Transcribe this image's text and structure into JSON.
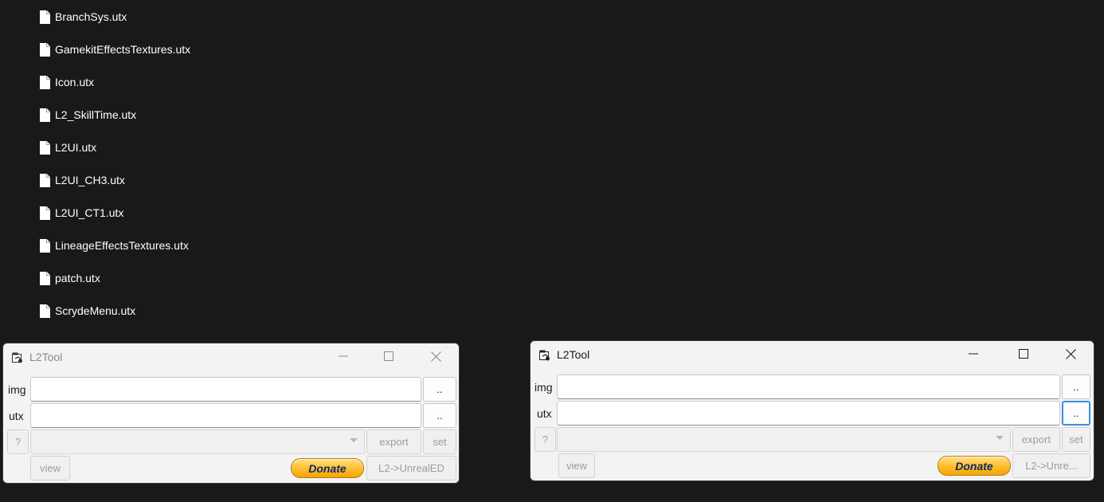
{
  "desktop_files": [
    {
      "name": "BranchSys.utx"
    },
    {
      "name": "GamekitEffectsTextures.utx"
    },
    {
      "name": "Icon.utx"
    },
    {
      "name": "L2_SkillTime.utx"
    },
    {
      "name": "L2UI.utx"
    },
    {
      "name": "L2UI_CH3.utx"
    },
    {
      "name": "L2UI_CT1.utx"
    },
    {
      "name": "LineageEffectsTextures.utx"
    },
    {
      "name": "patch.utx"
    },
    {
      "name": "ScrydeMenu.utx"
    }
  ],
  "windows": [
    {
      "title": "L2Tool",
      "state": "inactive",
      "img_label": "img",
      "utx_label": "utx",
      "img_value": "",
      "utx_value": "",
      "browse_img_label": "..",
      "browse_utx_label": "..",
      "help_label": "?",
      "texture_select_value": "",
      "export_label": "export",
      "set_label": "set",
      "view_label": "view",
      "donate_label": "Donate",
      "convert_label": "L2->UnrealED"
    },
    {
      "title": "L2Tool",
      "state": "active",
      "img_label": "img",
      "utx_label": "utx",
      "img_value": "",
      "utx_value": "",
      "browse_img_label": "..",
      "browse_utx_label": "..",
      "help_label": "?",
      "texture_select_value": "",
      "export_label": "export",
      "set_label": "set",
      "view_label": "view",
      "donate_label": "Donate",
      "convert_label": "L2->Unre..."
    }
  ],
  "icons": {
    "file": "document-icon",
    "app": "l2tool-app-icon",
    "minimize": "minimize-icon",
    "maximize": "maximize-icon",
    "close": "close-icon"
  },
  "colors": {
    "desktop_background": "#191919",
    "window_background": "#f3f3f3",
    "focus_ring": "#3d8ee2",
    "donate_gold": "#ffc23a",
    "donate_text": "#0d2a6b"
  }
}
